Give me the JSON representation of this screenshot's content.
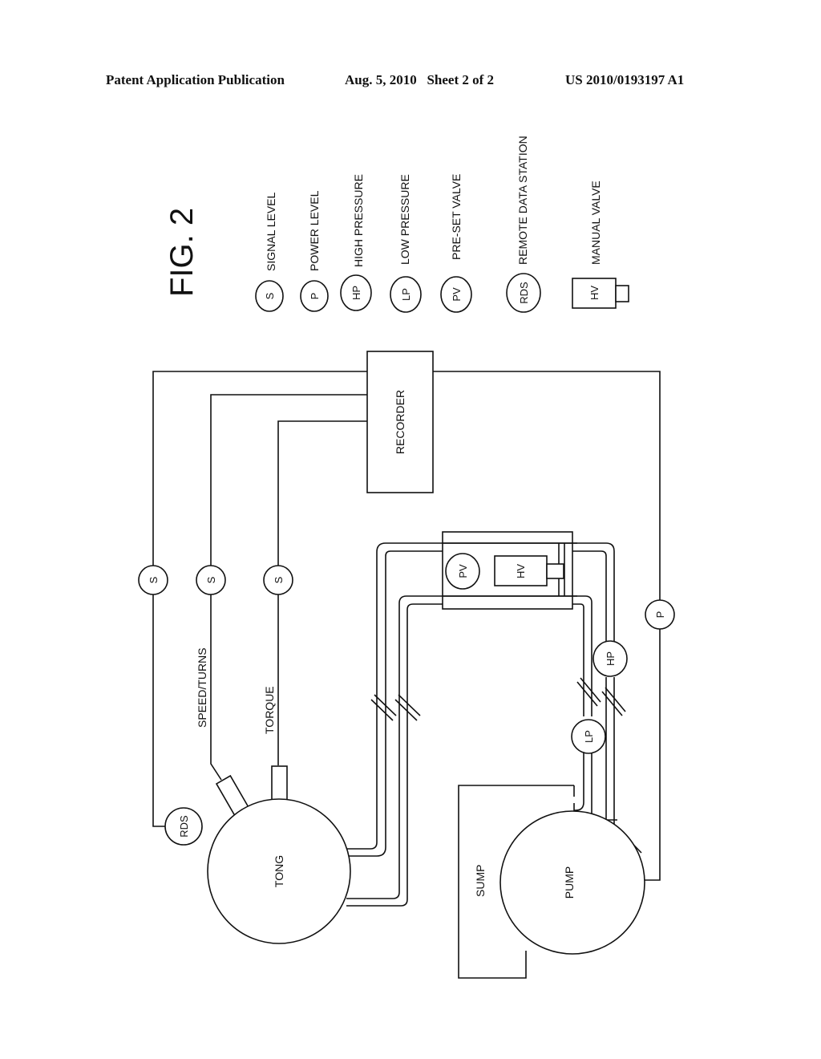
{
  "header": {
    "publication": "Patent Application Publication",
    "date_sheet": "Aug. 5, 2010   Sheet 2 of 2",
    "number": "US 2010/0193197 A1"
  },
  "figure": {
    "title": "FIG. 2",
    "legend": [
      {
        "symbol": "S",
        "label": "SIGNAL LEVEL"
      },
      {
        "symbol": "P",
        "label": "POWER LEVEL"
      },
      {
        "symbol": "HP",
        "label": "HIGH PRESSURE"
      },
      {
        "symbol": "LP",
        "label": "LOW PRESSURE"
      },
      {
        "symbol": "PV",
        "label": "PRE-SET VALVE"
      },
      {
        "symbol": "RDS",
        "label": "REMOTE DATA STATION"
      },
      {
        "symbol": "HV",
        "label": "MANUAL VALVE"
      }
    ],
    "components": {
      "recorder": "RECORDER",
      "tong": "TONG",
      "pump": "PUMP",
      "sump": "SUMP",
      "rds": "RDS",
      "signal_1": "S",
      "signal_2": "S",
      "signal_3": "S",
      "power": "P",
      "high_pressure": "HP",
      "low_pressure": "LP",
      "preset_valve": "PV",
      "manual_valve": "HV",
      "speed_turns_label": "SPEED/TURNS",
      "torque_label": "TORQUE"
    }
  }
}
